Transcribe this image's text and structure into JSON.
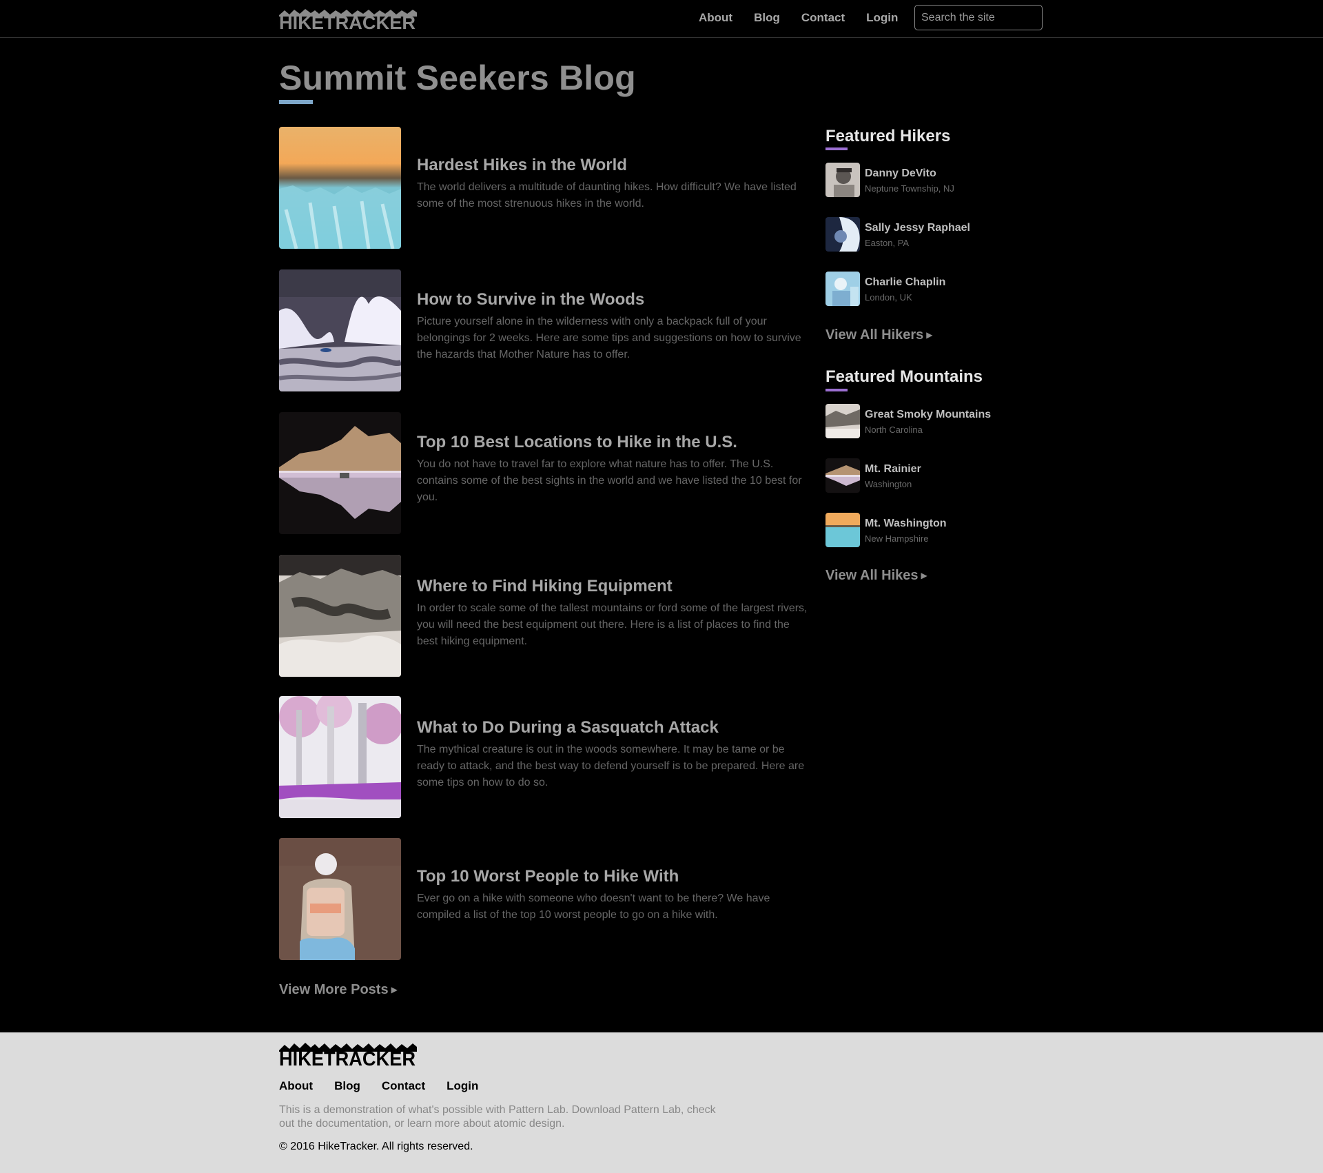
{
  "header": {
    "logo_text": "HIKETRACKER",
    "nav": [
      "About",
      "Blog",
      "Contact",
      "Login"
    ],
    "search_placeholder": "Search the site"
  },
  "page_title": "Summit Seekers Blog",
  "posts": [
    {
      "title": "Hardest Hikes in the World",
      "excerpt": "The world delivers a multitude of daunting hikes. How difficult? We have listed some of the most strenuous hikes in the world.",
      "image": "glacier-sunset-image"
    },
    {
      "title": "How to Survive in the Woods",
      "excerpt": "Picture yourself alone in the wilderness with only a backpack full of your belongings for 2 weeks. Here are some tips and suggestions on how to survive the hazards that Mother Nature has to offer.",
      "image": "snowy-trees-river-image"
    },
    {
      "title": "Top 10 Best Locations to Hike in the U.S.",
      "excerpt": "You do not have to travel far to explore what nature has to offer. The U.S. contains some of the best sights in the world and we have listed the 10 best for you.",
      "image": "lake-reflection-image"
    },
    {
      "title": "Where to Find Hiking Equipment",
      "excerpt": "In order to scale some of the tallest mountains or ford some of the largest rivers, you will need the best equipment out there. Here is a list of places to find the best hiking equipment.",
      "image": "rocky-mountain-image"
    },
    {
      "title": "What to Do During a Sasquatch Attack",
      "excerpt": "The mythical creature is out in the woods somewhere. It may be tame or be ready to attack, and the best way to defend yourself is to be prepared. Here are some tips on how to do so.",
      "image": "forest-swamp-image"
    },
    {
      "title": "Top 10 Worst People to Hike With",
      "excerpt": "Ever go on a hike with someone who doesn't want to be there? We have compiled a list of the top 10 worst people to go on a hike with.",
      "image": "backpacker-image"
    }
  ],
  "view_more_posts": "View More Posts",
  "featured_hikers": {
    "heading": "Featured Hikers",
    "items": [
      {
        "name": "Danny DeVito",
        "location": "Neptune Township, NJ"
      },
      {
        "name": "Sally Jessy Raphael",
        "location": "Easton, PA"
      },
      {
        "name": "Charlie Chaplin",
        "location": "London, UK"
      }
    ],
    "view_all": "View All Hikers"
  },
  "featured_mountains": {
    "heading": "Featured Mountains",
    "items": [
      {
        "name": "Great Smoky Mountains",
        "location": "North Carolina"
      },
      {
        "name": "Mt. Rainier",
        "location": "Washington"
      },
      {
        "name": "Mt. Washington",
        "location": "New Hampshire"
      }
    ],
    "view_all": "View All Hikes"
  },
  "footer": {
    "nav": [
      "About",
      "Blog",
      "Contact",
      "Login"
    ],
    "text": "This is a demonstration of what's possible with Pattern Lab. Download Pattern Lab, check out the documentation, or learn more about atomic design.",
    "copyright": "© 2016 HikeTracker. All rights reserved."
  },
  "colors": {
    "background": "#000000",
    "title_accent": "#7ea7c9",
    "sidebar_accent": "#9b6fd1",
    "footer_background": "#dcdcdc"
  }
}
